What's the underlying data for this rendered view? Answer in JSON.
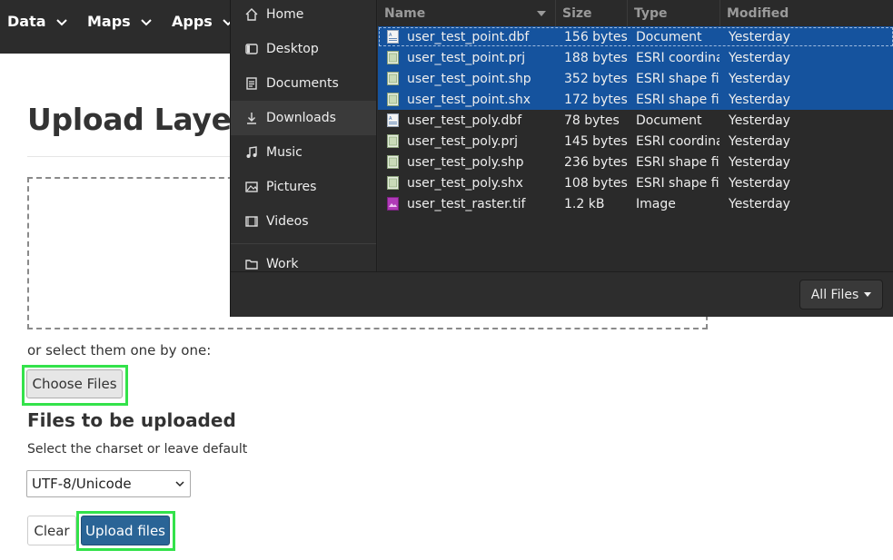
{
  "navbar": {
    "items": [
      {
        "label": "Data"
      },
      {
        "label": "Maps"
      },
      {
        "label": "Apps"
      }
    ]
  },
  "main": {
    "title": "Upload Layers",
    "select_text": "or select them one by one:",
    "choose_button": "Choose Files",
    "section_title": "Files to be uploaded",
    "charset_label": "Select the charset or leave default",
    "charset_value": "UTF-8/Unicode",
    "clear_button": "Clear",
    "upload_button": "Upload files"
  },
  "dialog": {
    "sidebar": [
      {
        "label": "Home",
        "icon": "home-icon"
      },
      {
        "label": "Desktop",
        "icon": "desktop-icon"
      },
      {
        "label": "Documents",
        "icon": "documents-icon"
      },
      {
        "label": "Downloads",
        "icon": "downloads-icon"
      },
      {
        "label": "Music",
        "icon": "music-icon"
      },
      {
        "label": "Pictures",
        "icon": "pictures-icon"
      },
      {
        "label": "Videos",
        "icon": "videos-icon"
      },
      {
        "label": "Work",
        "icon": "folder-icon"
      }
    ],
    "columns": {
      "name": "Name",
      "size": "Size",
      "type": "Type",
      "modified": "Modified"
    },
    "files": [
      {
        "name": "user_test_point.dbf",
        "size": "156 bytes",
        "type": "Document",
        "modified": "Yesterday",
        "icon": "document-icon",
        "selected": true
      },
      {
        "name": "user_test_point.prj",
        "size": "188 bytes",
        "type": "ESRI coordina",
        "modified": "Yesterday",
        "icon": "generic-file-icon",
        "selected": true
      },
      {
        "name": "user_test_point.shp",
        "size": "352 bytes",
        "type": "ESRI shape file",
        "modified": "Yesterday",
        "icon": "generic-file-icon",
        "selected": true
      },
      {
        "name": "user_test_point.shx",
        "size": "172 bytes",
        "type": "ESRI shape file",
        "modified": "Yesterday",
        "icon": "generic-file-icon",
        "selected": true
      },
      {
        "name": "user_test_poly.dbf",
        "size": "78 bytes",
        "type": "Document",
        "modified": "Yesterday",
        "icon": "document-icon",
        "selected": false
      },
      {
        "name": "user_test_poly.prj",
        "size": "145 bytes",
        "type": "ESRI coordina",
        "modified": "Yesterday",
        "icon": "generic-file-icon",
        "selected": false
      },
      {
        "name": "user_test_poly.shp",
        "size": "236 bytes",
        "type": "ESRI shape file",
        "modified": "Yesterday",
        "icon": "generic-file-icon",
        "selected": false
      },
      {
        "name": "user_test_poly.shx",
        "size": "108 bytes",
        "type": "ESRI shape file",
        "modified": "Yesterday",
        "icon": "generic-file-icon",
        "selected": false
      },
      {
        "name": "user_test_raster.tif",
        "size": "1.2 kB",
        "type": "Image",
        "modified": "Yesterday",
        "icon": "image-file-icon",
        "selected": false
      }
    ],
    "filter_label": "All Files"
  },
  "colors": {
    "navbar_bg": "#2c2c2c",
    "dialog_bg": "#2d2d2d",
    "selection": "#15539e",
    "primary_button": "#2a6496",
    "highlight": "#33e24a"
  }
}
